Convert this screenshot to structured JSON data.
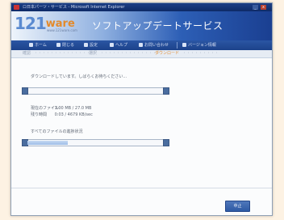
{
  "window": {
    "title": "ロ日本パーツ・サービス - Microsoft Internet Explorer",
    "minimize_label": "_",
    "close_label": "x"
  },
  "banner": {
    "logo_number": "121",
    "logo_word": "ware",
    "logo_sub": "www.121ware.com",
    "title": "ソフトアップデートサービス"
  },
  "nav": {
    "items": [
      {
        "label": "ホーム",
        "icon": "home-icon"
      },
      {
        "label": "閉じる",
        "icon": "close-icon"
      },
      {
        "label": "設定",
        "icon": "gear-icon"
      },
      {
        "label": "ヘルプ",
        "icon": "help-icon"
      },
      {
        "label": "お問い合わせ",
        "icon": "mail-icon"
      },
      {
        "label": "バージョン情報",
        "icon": "info-icon"
      }
    ]
  },
  "steps": {
    "step1": "確認",
    "dots1": "・・・・・・・・・・・・・・・",
    "step2": "選択",
    "dots2": "・・・・・・・・・・・・・・・",
    "step3_current": "ダウンロード",
    "dots3": "・・・・・・・・・"
  },
  "download": {
    "status_text": "ダウンロードしています。しばらくお待ちください...",
    "progress_current": 0,
    "rows": [
      {
        "key": "現在のファイル",
        "value": "1.00 MB / 27.0 MB"
      },
      {
        "key": "残り時間",
        "value": "0:03 / 4679 KB/sec"
      }
    ],
    "total_label": "すべてのファイルの進捗状況",
    "progress_total": 0.3
  },
  "footer": {
    "cancel_label": "中止"
  }
}
